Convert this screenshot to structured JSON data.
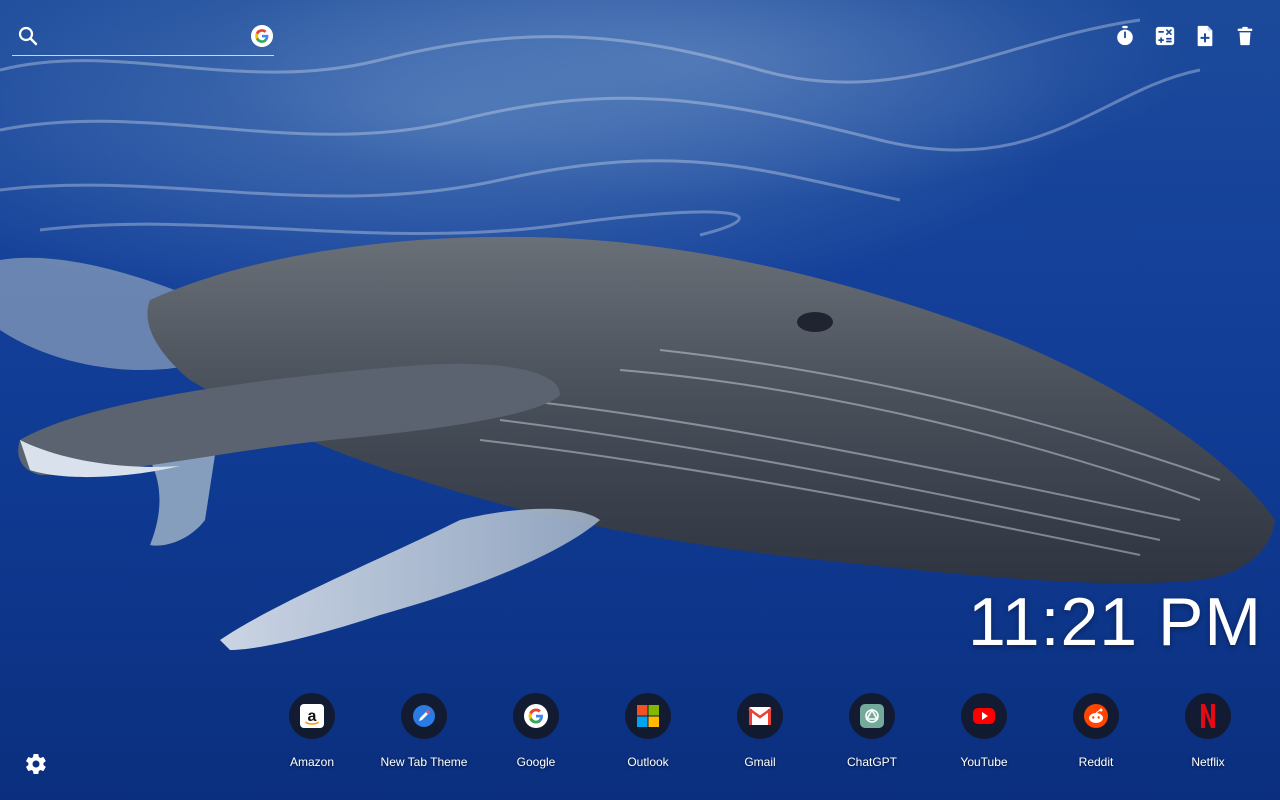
{
  "search": {
    "icon": "search-icon",
    "placeholder": "",
    "value": "",
    "engine_icon": "google-icon"
  },
  "toolbar": {
    "tools": [
      {
        "icon": "stopwatch-icon"
      },
      {
        "icon": "calculator-icon"
      },
      {
        "icon": "add-note-icon"
      },
      {
        "icon": "trash-icon"
      }
    ]
  },
  "wallpaper": {
    "subject": "humpback whale underwater",
    "colors": {
      "water_top": "#1c4a9a",
      "water_bottom": "#0b2f7e",
      "whale": "#4a505a"
    }
  },
  "clock": {
    "time": "11:21 PM"
  },
  "shortcuts": [
    {
      "label": "Amazon",
      "icon": "amazon-icon"
    },
    {
      "label": "New Tab Theme",
      "icon": "new-tab-theme-icon"
    },
    {
      "label": "Google",
      "icon": "google-icon"
    },
    {
      "label": "Outlook",
      "icon": "microsoft-icon"
    },
    {
      "label": "Gmail",
      "icon": "gmail-icon"
    },
    {
      "label": "ChatGPT",
      "icon": "chatgpt-icon"
    },
    {
      "label": "YouTube",
      "icon": "youtube-icon"
    },
    {
      "label": "Reddit",
      "icon": "reddit-icon"
    },
    {
      "label": "Netflix",
      "icon": "netflix-icon"
    }
  ],
  "settings": {
    "icon": "gear-icon"
  }
}
